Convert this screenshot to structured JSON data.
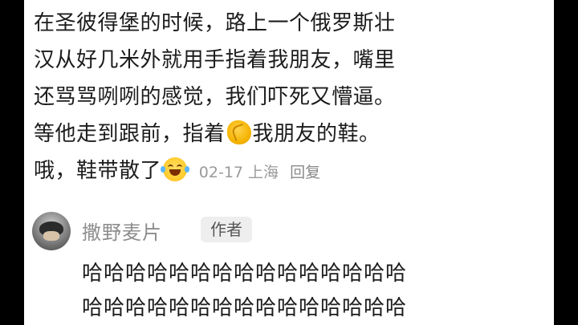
{
  "comment": {
    "lines": [
      "在圣彼得堡的时候，路上一个俄罗斯壮",
      "汉从好几米外就用手指着我朋友，嘴里",
      "还骂骂咧咧的感觉，我们吓死又懵逼。",
      "等他走到跟前，指着",
      "我朋友的鞋。",
      "哦，鞋带散了"
    ],
    "emoji_clap": "clapping-hands",
    "emoji_laugh": "laughing-with-tears",
    "date": "02-17",
    "location": "上海",
    "reply_label": "回复"
  },
  "reply": {
    "username": "撒野麦片",
    "badge": "作者",
    "lines": [
      "哈哈哈哈哈哈哈哈哈哈哈哈哈哈哈",
      "哈哈哈哈哈哈哈哈哈哈哈哈哈哈哈"
    ]
  }
}
